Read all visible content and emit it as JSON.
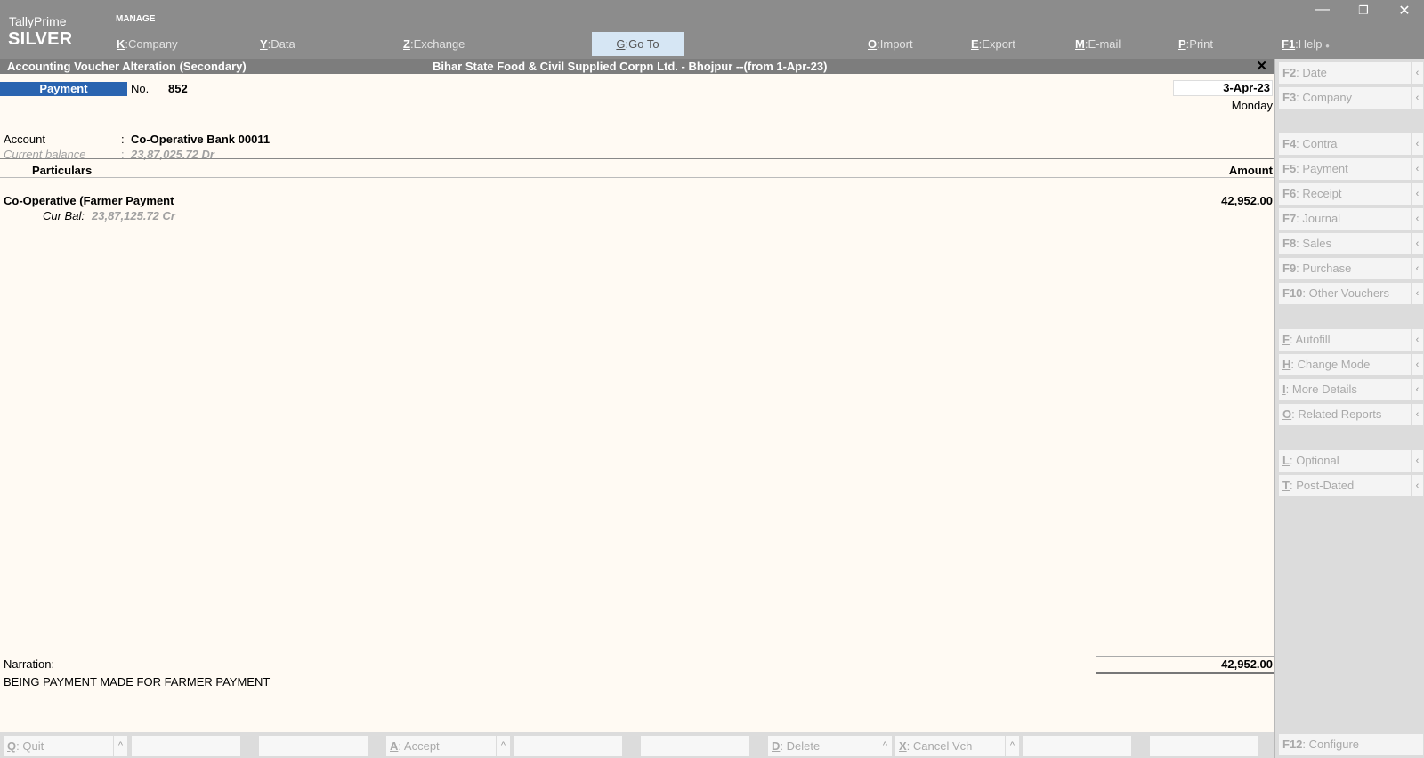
{
  "app": {
    "name": "TallyPrime",
    "edition": "SILVER",
    "manage_label": "MANAGE"
  },
  "top_menu": [
    {
      "key": "K",
      "label": "Company"
    },
    {
      "key": "Y",
      "label": "Data"
    },
    {
      "key": "Z",
      "label": "Exchange"
    },
    {
      "key": "G",
      "label": "Go To"
    },
    {
      "key": "O",
      "label": "Import"
    },
    {
      "key": "E",
      "label": "Export"
    },
    {
      "key": "M",
      "label": "E-mail"
    },
    {
      "key": "P",
      "label": "Print"
    },
    {
      "key": "F1",
      "label": "Help"
    }
  ],
  "window_controls": {
    "minimize": "—",
    "restore": "❐",
    "close": "✕"
  },
  "title_bar": {
    "screen_title": "Accounting Voucher Alteration (Secondary)",
    "company": "Bihar State Food & Civil Supplied Corpn Ltd. - Bhojpur --(from 1-Apr-23)",
    "close_glyph": "✕"
  },
  "voucher": {
    "type": "Payment",
    "no_label": "No.",
    "number": "852",
    "date": "3-Apr-23",
    "day": "Monday",
    "account_label": "Account",
    "account_value": "Co-Operative Bank 00011",
    "balance_label": "Current balance",
    "balance_value": "23,87,025.72 Dr",
    "colon": ":",
    "columns": {
      "particulars": "Particulars",
      "amount": "Amount"
    },
    "entries": [
      {
        "ledger": "Co-Operative (Farmer Payment",
        "amount": "42,952.00",
        "cur_bal_label": "Cur Bal:",
        "cur_bal_value": "23,87,125.72 Cr"
      }
    ],
    "narration_label": "Narration:",
    "narration": "BEING PAYMENT MADE FOR FARMER PAYMENT",
    "total": "42,952.00"
  },
  "right_buttons": [
    {
      "key": "F2",
      "label": "Date"
    },
    {
      "key": "F3",
      "label": "Company"
    },
    {
      "key": "F4",
      "label": "Contra"
    },
    {
      "key": "F5",
      "label": "Payment"
    },
    {
      "key": "F6",
      "label": "Receipt"
    },
    {
      "key": "F7",
      "label": "Journal"
    },
    {
      "key": "F8",
      "label": "Sales"
    },
    {
      "key": "F9",
      "label": "Purchase"
    },
    {
      "key": "F10",
      "label": "Other Vouchers"
    },
    {
      "key": "F",
      "label": "Autofill"
    },
    {
      "key": "H",
      "label": "Change Mode"
    },
    {
      "key": "I",
      "label": "More Details"
    },
    {
      "key": "O",
      "label": "Related Reports"
    },
    {
      "key": "L",
      "label": "Optional"
    },
    {
      "key": "T",
      "label": "Post-Dated"
    },
    {
      "key": "F12",
      "label": "Configure"
    }
  ],
  "bottom_buttons": [
    {
      "key": "Q",
      "label": "Quit"
    },
    {
      "key": "A",
      "label": "Accept"
    },
    {
      "key": "D",
      "label": "Delete"
    },
    {
      "key": "X",
      "label": "Cancel Vch"
    }
  ],
  "glyphs": {
    "side_arrow": "‹",
    "caret_up": "^",
    "help_dot": "●",
    "sep": ":"
  }
}
